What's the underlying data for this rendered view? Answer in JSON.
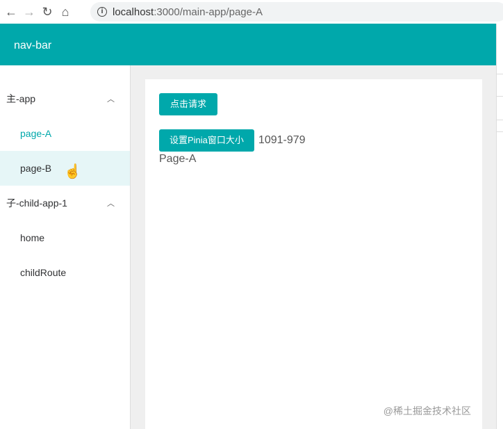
{
  "browser": {
    "url_host": "localhost",
    "url_rest": ":3000/main-app/page-A"
  },
  "navbar": {
    "title": "nav-bar"
  },
  "sidebar": {
    "groups": [
      {
        "label": "主-app",
        "items": [
          "page-A",
          "page-B"
        ]
      },
      {
        "label": "子-child-app-1",
        "items": [
          "home",
          "childRoute"
        ]
      }
    ]
  },
  "main": {
    "request_button": "点击请求",
    "set_size_button": "设置Pinia窗口大小",
    "size_value": "1091-979",
    "page_label": "Page-A"
  },
  "watermark": "@稀土掘金技术社区"
}
